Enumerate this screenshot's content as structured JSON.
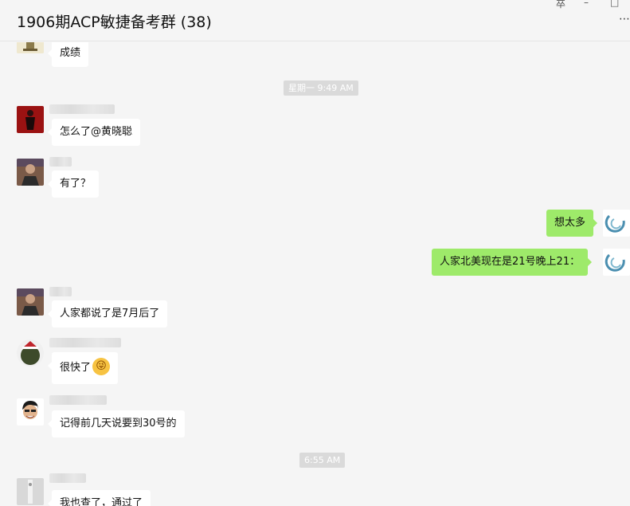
{
  "window": {
    "title": "1906期ACP敏捷备考群 (38)",
    "pin_glyph": "卒",
    "minimize_glyph": "–",
    "maximize_glyph": "□",
    "more_glyph": "⋯"
  },
  "timestamps": [
    "星期一 9:49 AM",
    "6:55 AM"
  ],
  "messages": [
    {
      "text": "成绩"
    },
    {
      "text": "怎么了@黄晓聪"
    },
    {
      "text": "有了？"
    },
    {
      "text": "想太多"
    },
    {
      "text": "人家北美现在是21号晚上21："
    },
    {
      "text": "人家都说了是7月后了"
    },
    {
      "text": "很快了",
      "emoji": "😜"
    },
    {
      "text": "记得前几天说要到30号的"
    },
    {
      "text": "我也查了，通过了"
    }
  ],
  "colors": {
    "background": "#f5f5f5",
    "incoming_bubble": "#ffffff",
    "outgoing_bubble": "#9eea6a",
    "timestamp_pill": "#dadada"
  },
  "icons": {
    "emoji": "winking-tongue-emoji-icon"
  }
}
